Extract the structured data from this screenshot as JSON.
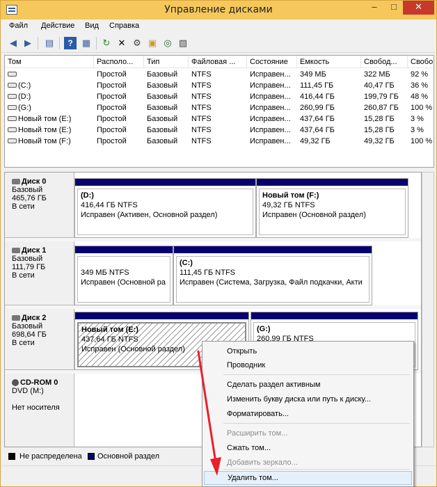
{
  "window": {
    "title": "Управление дисками"
  },
  "menu": [
    "Файл",
    "Действие",
    "Вид",
    "Справка"
  ],
  "toolbar_icons": [
    "back-arrow-icon",
    "forward-arrow-icon",
    "console-tree-icon",
    "help-icon",
    "properties-icon",
    "refresh-icon",
    "delete-icon",
    "settings-icon",
    "open-folder-icon",
    "search-icon",
    "properties-sheet-icon"
  ],
  "volumes": {
    "columns": [
      "Том",
      "Располо...",
      "Тип",
      "Файловая ...",
      "Состояние",
      "Емкость",
      "Свобод...",
      "Свобо"
    ],
    "rows": [
      [
        "",
        "Простой",
        "Базовый",
        "NTFS",
        "Исправен...",
        "349 МБ",
        "322 МБ",
        "92 %"
      ],
      [
        "(C:)",
        "Простой",
        "Базовый",
        "NTFS",
        "Исправен...",
        "111,45 ГБ",
        "40,47 ГБ",
        "36 %"
      ],
      [
        "(D:)",
        "Простой",
        "Базовый",
        "NTFS",
        "Исправен...",
        "416,44 ГБ",
        "199,79 ГБ",
        "48 %"
      ],
      [
        "(G:)",
        "Простой",
        "Базовый",
        "NTFS",
        "Исправен...",
        "260,99 ГБ",
        "260,87 ГБ",
        "100 %"
      ],
      [
        "Новый том (E:)",
        "Простой",
        "Базовый",
        "NTFS",
        "Исправен...",
        "437,64 ГБ",
        "15,28 ГБ",
        "3 %"
      ],
      [
        "Новый том (E:)",
        "Простой",
        "Базовый",
        "NTFS",
        "Исправен...",
        "437,64 ГБ",
        "15,28 ГБ",
        "3 %"
      ],
      [
        "Новый том (F:)",
        "Простой",
        "Базовый",
        "NTFS",
        "Исправен...",
        "49,32 ГБ",
        "49,32 ГБ",
        "100 %"
      ]
    ]
  },
  "disks": [
    {
      "name": "Диск 0",
      "type": "Базовый",
      "size": "465,76 ГБ",
      "status": "В сети",
      "partitions": [
        {
          "name": "(D:)",
          "size": "416,44 ГБ NTFS",
          "status": "Исправен (Активен, Основной раздел)"
        },
        {
          "name": "Новый том  (F:)",
          "size": "49,32 ГБ NTFS",
          "status": "Исправен (Основной раздел)"
        }
      ]
    },
    {
      "name": "Диск 1",
      "type": "Базовый",
      "size": "111,79 ГБ",
      "status": "В сети",
      "partitions": [
        {
          "name": "",
          "size": "349 МБ NTFS",
          "status": "Исправен (Основной ра"
        },
        {
          "name": "(C:)",
          "size": "111,45 ГБ NTFS",
          "status": "Исправен (Система, Загрузка, Файл подкачки, Акти"
        }
      ]
    },
    {
      "name": "Диск 2",
      "type": "Базовый",
      "size": "698,64 ГБ",
      "status": "В сети",
      "partitions": [
        {
          "name": "Новый том  (E:)",
          "size": "437,64 ГБ NTFS",
          "status": "Исправен (Основной раздел)"
        },
        {
          "name": "(G:)",
          "size": "260,99 ГБ NTFS",
          "status": ""
        }
      ]
    },
    {
      "name": "CD-ROM 0",
      "type": "DVD (M:)",
      "size": "",
      "status": "Нет носителя",
      "partitions": []
    }
  ],
  "legend": {
    "unallocated": "Не распределена",
    "primary": "Основной раздел",
    "unallocated_color": "#000000",
    "primary_color": "#08006c"
  },
  "context_menu": {
    "items": [
      {
        "label": "Открыть",
        "enabled": true
      },
      {
        "label": "Проводник",
        "enabled": true
      },
      {
        "label": "Сделать раздел активным",
        "enabled": true
      },
      {
        "label": "Изменить букву диска или путь к диску...",
        "enabled": true
      },
      {
        "label": "Форматировать...",
        "enabled": true
      },
      {
        "label": "Расширить том...",
        "enabled": false
      },
      {
        "label": "Сжать том...",
        "enabled": true
      },
      {
        "label": "Добавить зеркало...",
        "enabled": false
      },
      {
        "label": "Удалить том...",
        "enabled": true,
        "highlighted": true
      }
    ]
  },
  "colors": {
    "titlebar": "#f6c75a",
    "partition_header": "#08006c",
    "arrow": "#e8202a",
    "close_button": "#c7392b"
  }
}
